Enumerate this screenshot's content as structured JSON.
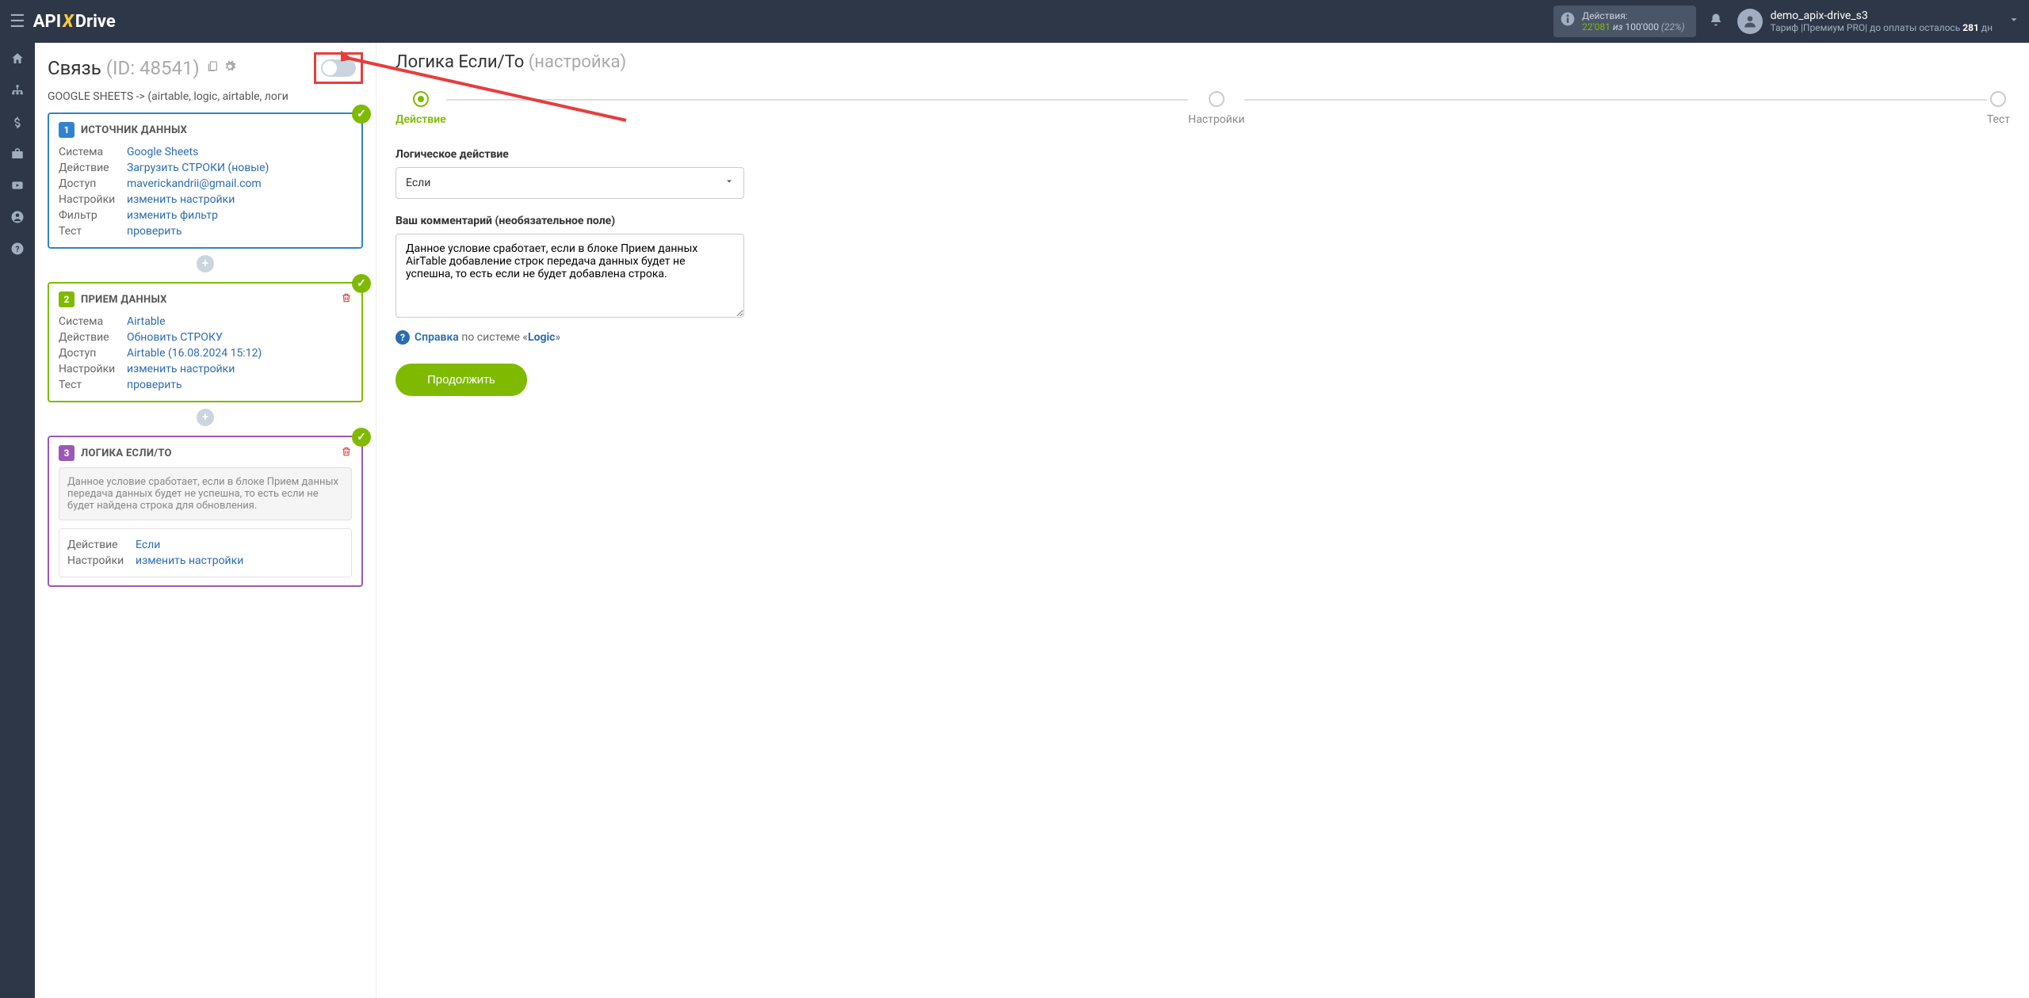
{
  "topbar": {
    "actions_label": "Действия:",
    "actions_current": "22'081",
    "actions_of": " из ",
    "actions_max": "100'000",
    "actions_pct": " (22%)",
    "username": "demo_apix-drive_s3",
    "tariff_prefix": "Тариф |Премиум PRO|  до оплаты осталось ",
    "tariff_days": "281",
    "tariff_suffix": " дн"
  },
  "left": {
    "conn_title": "Связь",
    "conn_id": "(ID: 48541)",
    "conn_sub": "GOOGLE SHEETS -> (airtable, logic, airtable, логи",
    "card1": {
      "num": "1",
      "title": "ИСТОЧНИК ДАННЫХ",
      "rows": {
        "system_l": "Система",
        "system_v": "Google Sheets",
        "action_l": "Действие",
        "action_v": "Загрузить СТРОКИ (новые)",
        "access_l": "Доступ",
        "access_v": "maverickandrii@gmail.com",
        "settings_l": "Настройки",
        "settings_v": "изменить настройки",
        "filter_l": "Фильтр",
        "filter_v": "изменить фильтр",
        "test_l": "Тест",
        "test_v": "проверить"
      }
    },
    "card2": {
      "num": "2",
      "title": "ПРИЕМ ДАННЫХ",
      "rows": {
        "system_l": "Система",
        "system_v": "Airtable",
        "action_l": "Действие",
        "action_v": "Обновить СТРОКУ",
        "access_l": "Доступ",
        "access_v": "Airtable (16.08.2024 15:12)",
        "settings_l": "Настройки",
        "settings_v": "изменить настройки",
        "test_l": "Тест",
        "test_v": "проверить"
      }
    },
    "card3": {
      "num": "3",
      "title": "ЛОГИКА ЕСЛИ/ТО",
      "note": "Данное условие сработает, если в блоке Прием данных передача данных будет не успешна, то есть если не будет найдена строка для обновления.",
      "rows": {
        "action_l": "Действие",
        "action_v": "Если",
        "settings_l": "Настройки",
        "settings_v": "изменить настройки"
      }
    }
  },
  "right": {
    "title": "Логика Если/То",
    "title_sub": " (настройка)",
    "steps": {
      "s1": "Действие",
      "s2": "Настройки",
      "s3": "Тест"
    },
    "logic_label": "Логическое действие",
    "select_value": "Если",
    "comment_label": "Ваш комментарий (необязательное поле)",
    "comment_value": "Данное условие сработает, если в блоке Прием данных AirTable добавление строк передача данных будет не успешна, то есть если не будет добавлена строка.",
    "help_link": "Справка",
    "help_rest_1": " по системе «",
    "help_rest_2": "Logic",
    "help_rest_3": "»",
    "continue": "Продолжить"
  }
}
